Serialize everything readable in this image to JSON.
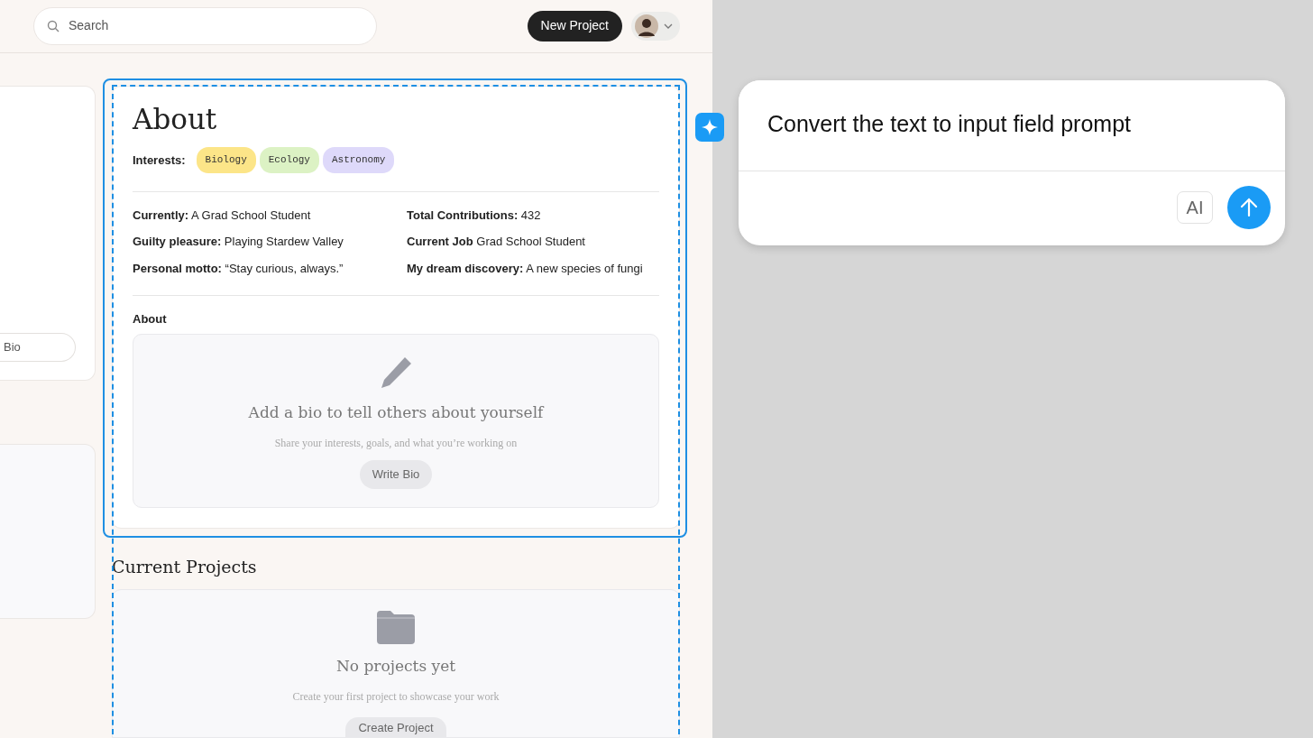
{
  "search": {
    "placeholder": "Search"
  },
  "header": {
    "new_project": "New Project"
  },
  "side_card": {
    "button": "Bio"
  },
  "about": {
    "title": "About",
    "interests_label": "Interests:",
    "interests": [
      {
        "label": "Biology",
        "color": "#fce588"
      },
      {
        "label": "Ecology",
        "color": "#dcf2c4"
      },
      {
        "label": "Astronomy",
        "color": "#ded9fa"
      }
    ],
    "facts": [
      {
        "label": "Currently:",
        "value": "A Grad School Student"
      },
      {
        "label": "Total Contributions:",
        "value": "432"
      },
      {
        "label": "Guilty pleasure:",
        "value": "Playing Stardew Valley"
      },
      {
        "label": "Current Job",
        "value": "Grad School Student"
      },
      {
        "label": "Personal motto:",
        "value": " “Stay curious, always.”"
      },
      {
        "label": "My dream discovery:",
        "value": "A new species of fungi"
      }
    ],
    "bio_label": "About",
    "bio_empty": {
      "title": "Add a bio to tell others about yourself",
      "subtitle": "Share your interests, goals, and what you’re working on",
      "button": "Write Bio"
    }
  },
  "projects": {
    "title": "Current Projects",
    "empty": {
      "title": "No projects yet",
      "subtitle": "Create your first project to showcase your work",
      "button": "Create Project"
    }
  },
  "prompt": {
    "value": "Convert the text to input field prompt",
    "ai_label": "AI"
  }
}
